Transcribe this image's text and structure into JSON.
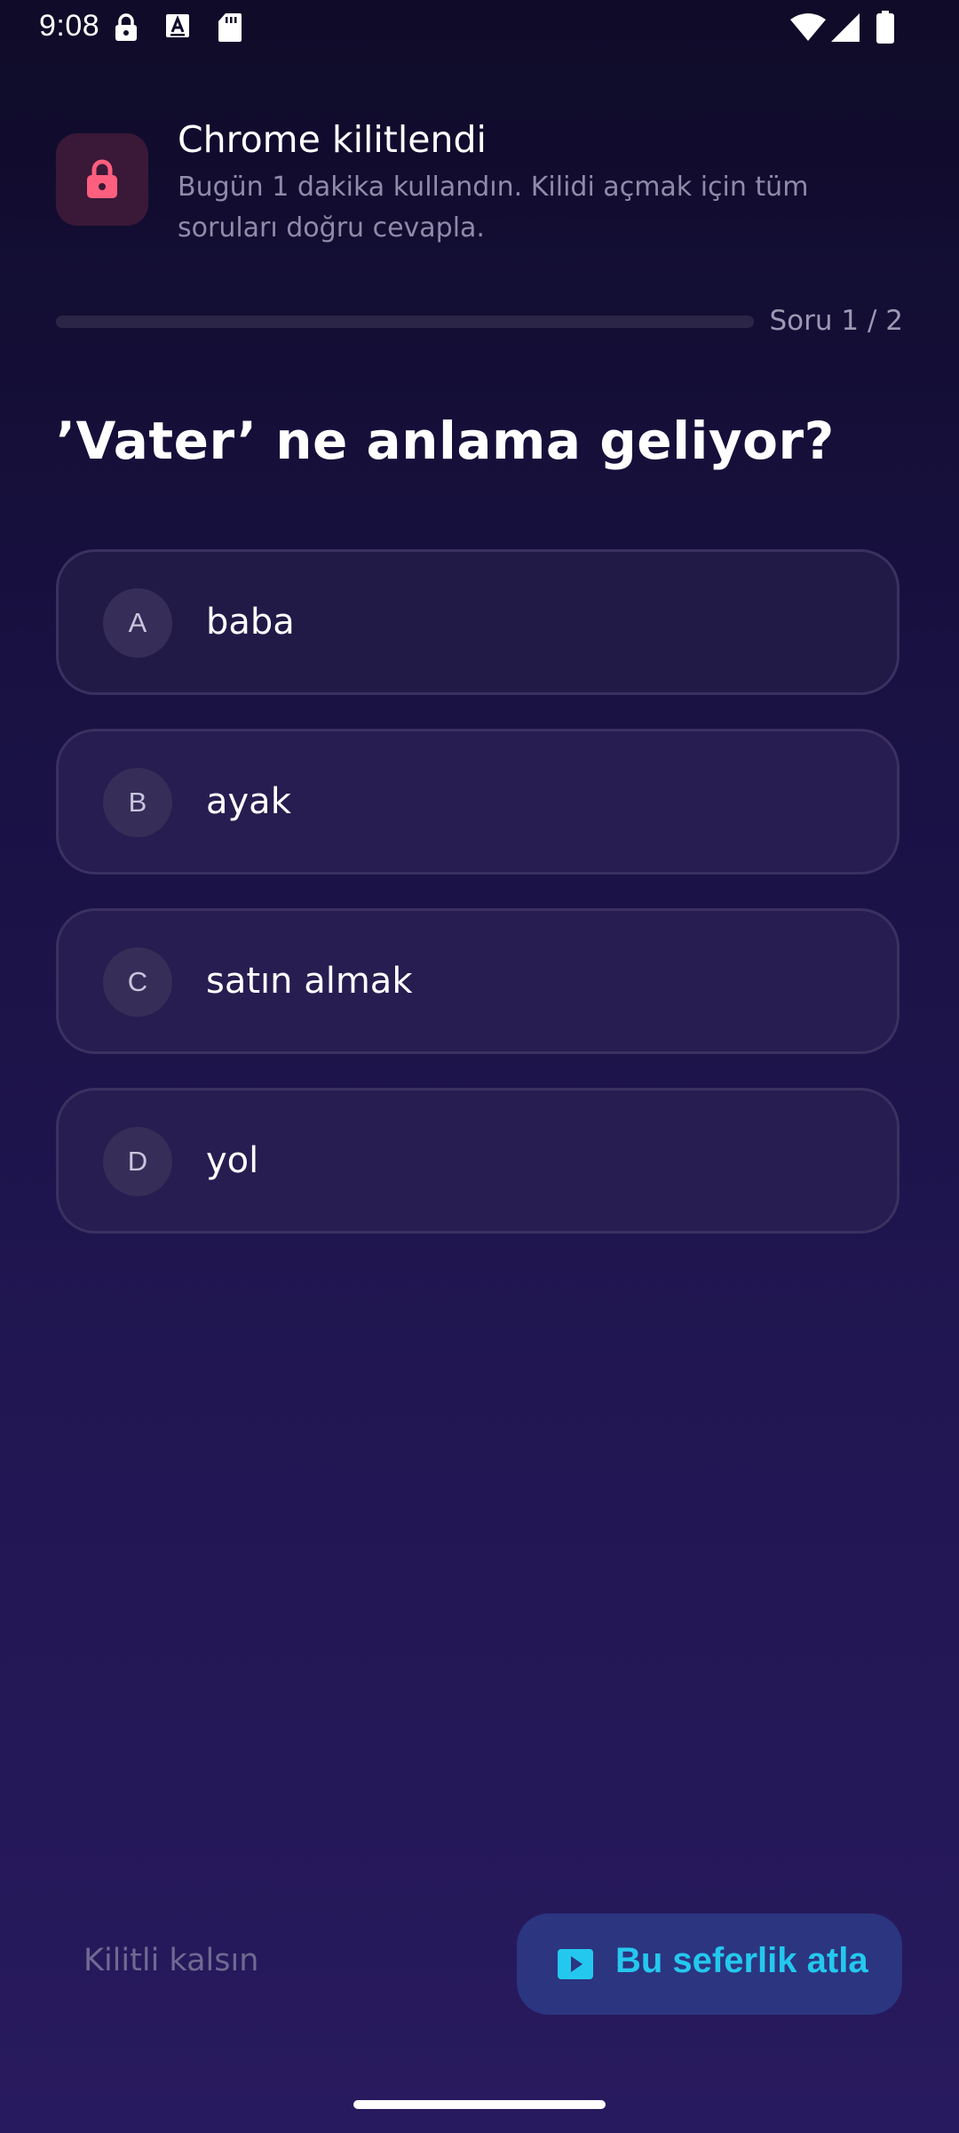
{
  "status_bar": {
    "time": "9:08",
    "icons": [
      "lock-icon",
      "text-a-icon",
      "sd-card-icon",
      "wifi-icon",
      "signal-icon",
      "battery-icon"
    ]
  },
  "header": {
    "icon": "lock-icon",
    "title": "Chrome kilitlendi",
    "subtitle": "Bugün 1 dakika kullandın. Kilidi açmak için tüm soruları doğru cevapla."
  },
  "progress": {
    "label": "Soru 1 / 2",
    "current": 1,
    "total": 2
  },
  "question": "’Vater’ ne anlama geliyor?",
  "options": [
    {
      "letter": "A",
      "text": "baba"
    },
    {
      "letter": "B",
      "text": "ayak"
    },
    {
      "letter": "C",
      "text": "satın almak"
    },
    {
      "letter": "D",
      "text": "yol"
    }
  ],
  "actions": {
    "stay_locked": "Kilitli kalsın",
    "skip": "Bu seferlik atla",
    "skip_icon": "play-video-icon"
  },
  "colors": {
    "accent": "#24c8ee",
    "lock_icon": "#ff5f7e",
    "button_bg": "#2c3580"
  }
}
